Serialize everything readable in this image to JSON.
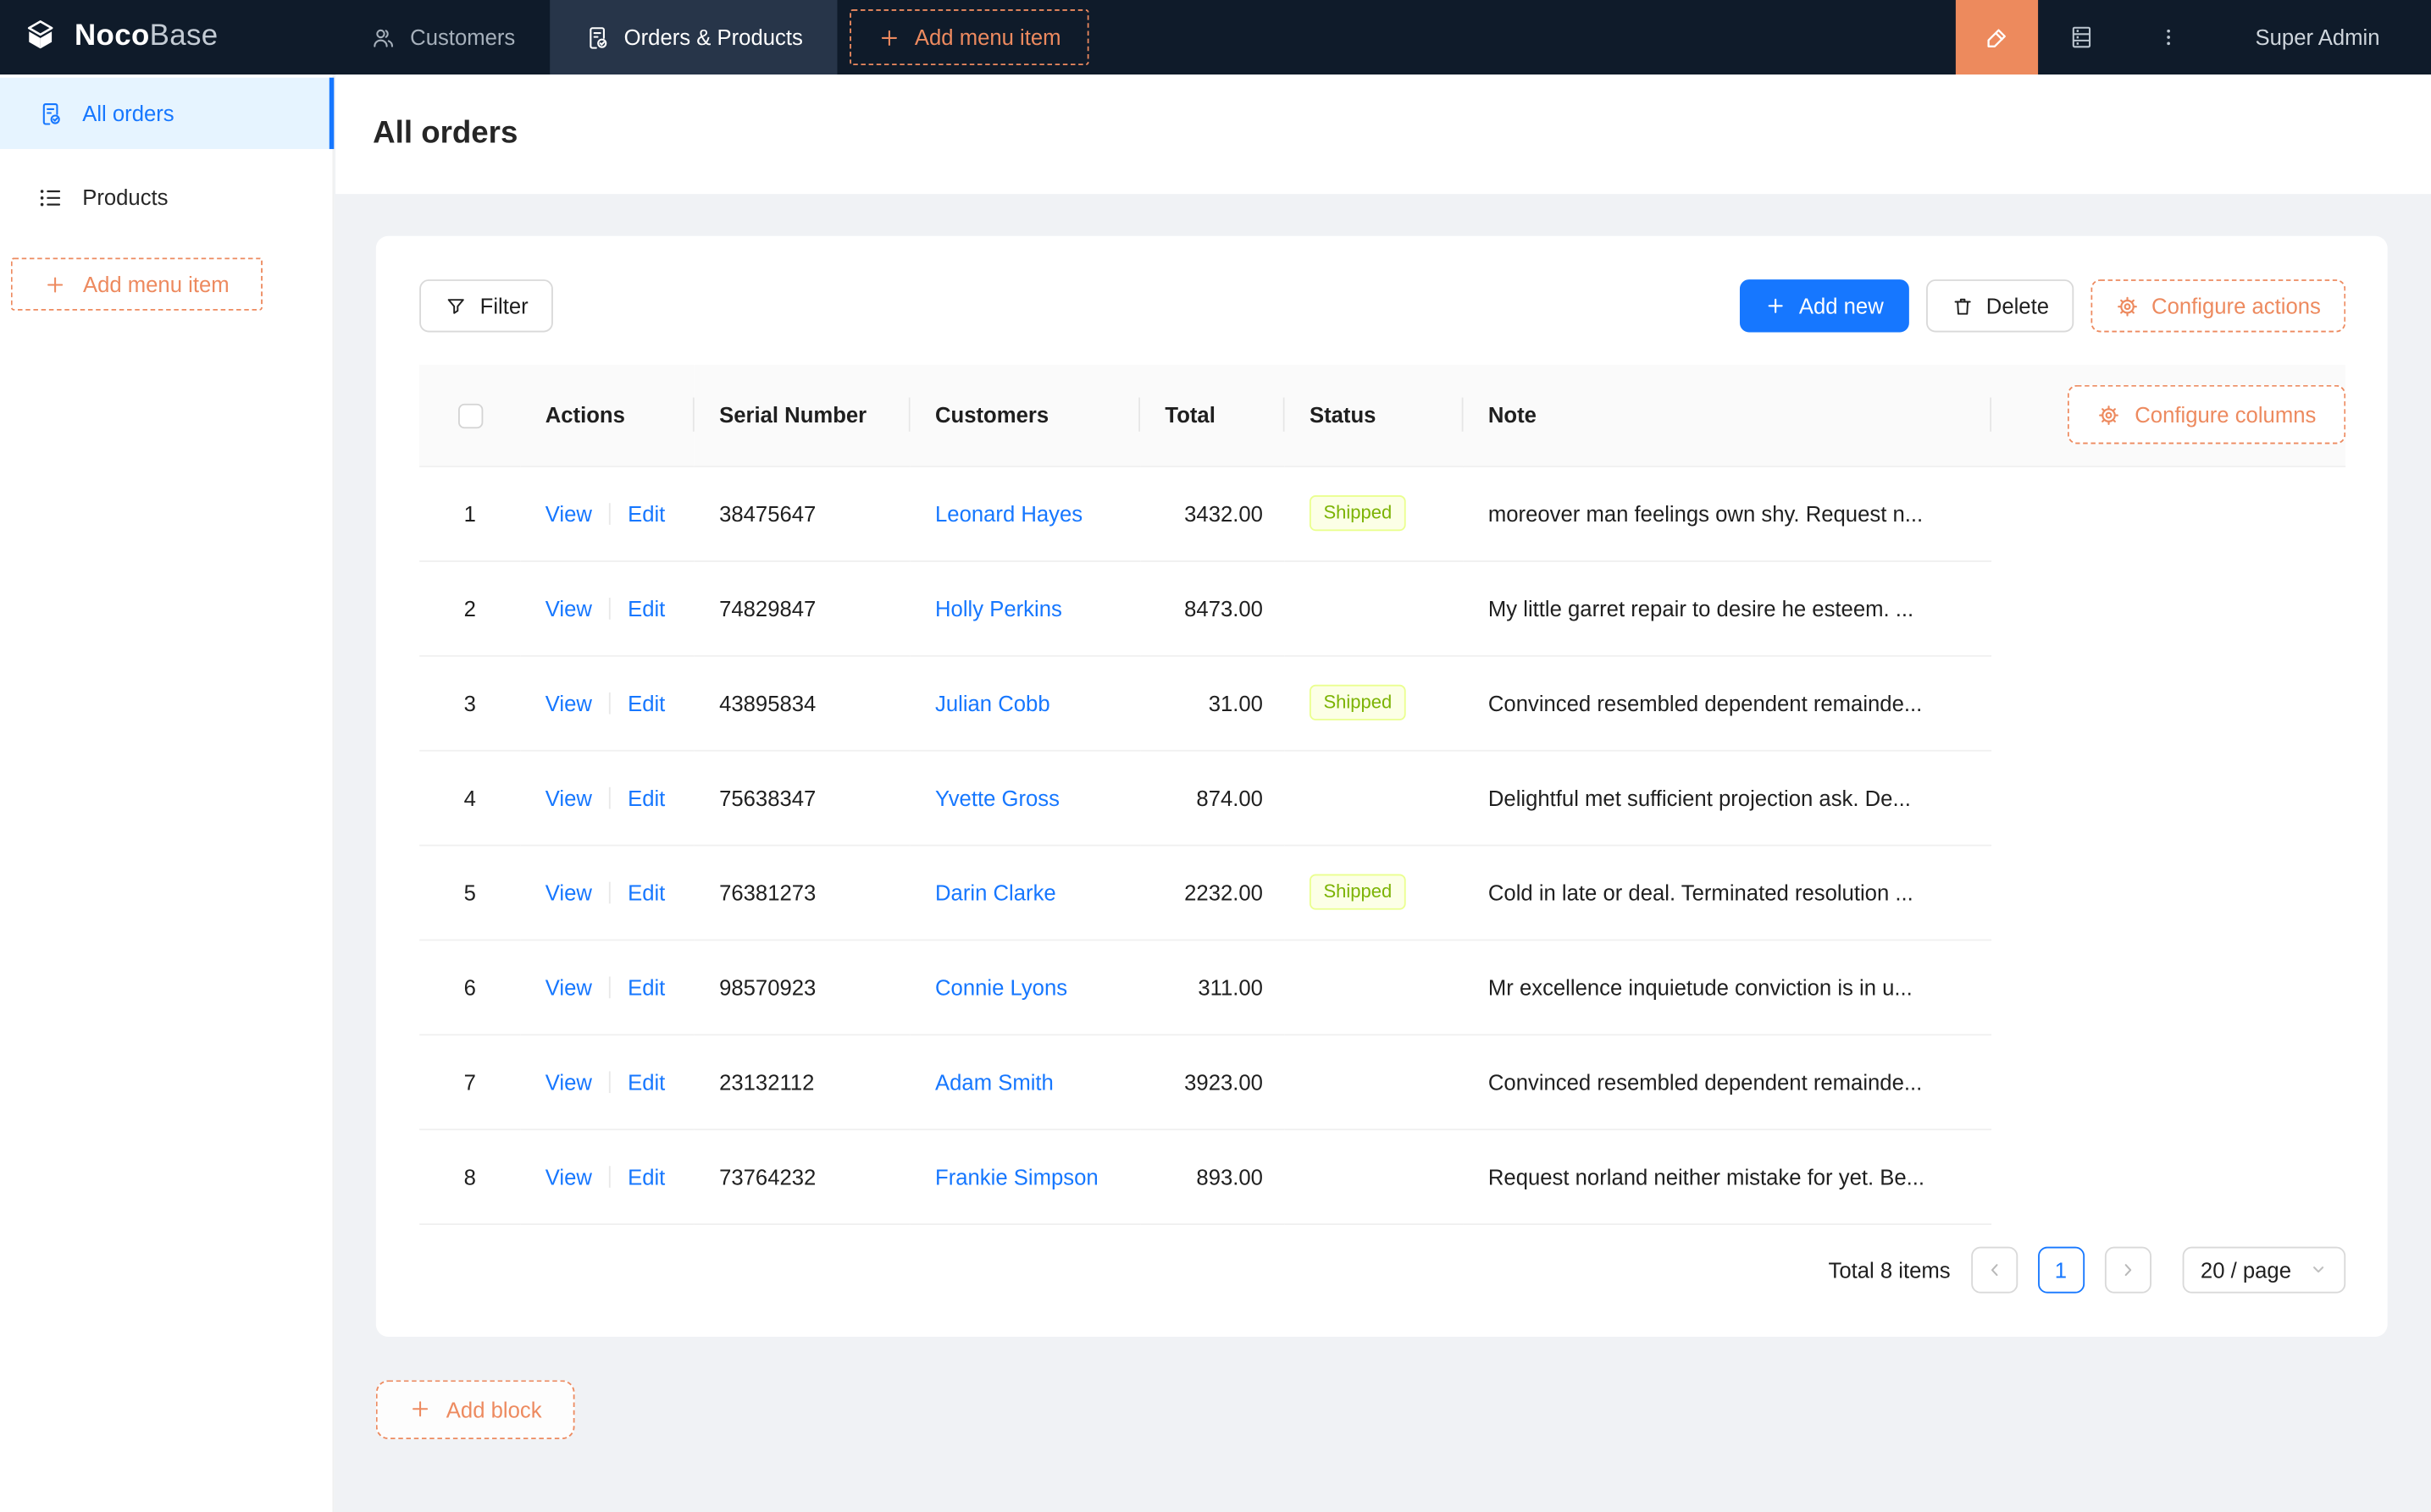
{
  "navbar": {
    "logo": {
      "part_bold": "Noco",
      "part_light": "Base"
    },
    "tabs": [
      {
        "label": "Customers",
        "icon": "users-icon",
        "active": false
      },
      {
        "label": "Orders & Products",
        "icon": "order-check-icon",
        "active": true
      }
    ],
    "add_menu_item_label": "Add menu item",
    "user": "Super Admin"
  },
  "sidebar": {
    "items": [
      {
        "label": "All orders",
        "icon": "order-check-icon",
        "active": true
      },
      {
        "label": "Products",
        "icon": "list-icon",
        "active": false
      }
    ],
    "add_menu_item_label": "Add menu item"
  },
  "page": {
    "title": "All orders"
  },
  "toolbar": {
    "filter_label": "Filter",
    "add_new_label": "Add new",
    "delete_label": "Delete",
    "configure_actions_label": "Configure actions"
  },
  "table": {
    "configure_columns_label": "Configure columns",
    "columns": [
      "Actions",
      "Serial Number",
      "Customers",
      "Total",
      "Status",
      "Note"
    ],
    "action_labels": {
      "view": "View",
      "edit": "Edit"
    },
    "rows": [
      {
        "index": 1,
        "serial": "38475647",
        "customer": "Leonard Hayes",
        "total": "3432.00",
        "status": "Shipped",
        "note": "moreover man feelings own shy. Request n..."
      },
      {
        "index": 2,
        "serial": "74829847",
        "customer": "Holly Perkins",
        "total": "8473.00",
        "status": "",
        "note": "My little garret repair to desire he esteem. ..."
      },
      {
        "index": 3,
        "serial": "43895834",
        "customer": "Julian Cobb",
        "total": "31.00",
        "status": "Shipped",
        "note": "Convinced resembled dependent remainde..."
      },
      {
        "index": 4,
        "serial": "75638347",
        "customer": "Yvette Gross",
        "total": "874.00",
        "status": "",
        "note": "Delightful met sufficient projection ask. De..."
      },
      {
        "index": 5,
        "serial": "76381273",
        "customer": "Darin Clarke",
        "total": "2232.00",
        "status": "Shipped",
        "note": "Cold in late or deal. Terminated resolution ..."
      },
      {
        "index": 6,
        "serial": "98570923",
        "customer": "Connie Lyons",
        "total": "311.00",
        "status": "",
        "note": "Mr excellence inquietude conviction is in u..."
      },
      {
        "index": 7,
        "serial": "23132112",
        "customer": "Adam Smith",
        "total": "3923.00",
        "status": "",
        "note": "Convinced resembled dependent remainde..."
      },
      {
        "index": 8,
        "serial": "73764232",
        "customer": "Frankie Simpson",
        "total": "893.00",
        "status": "",
        "note": "Request norland neither mistake for yet. Be..."
      }
    ],
    "pagination": {
      "total_text": "Total 8 items",
      "current_page": "1",
      "page_size": "20 / page"
    }
  },
  "add_block_label": "Add block",
  "icons": {
    "logo-icon": "cube",
    "users-icon": "two-people outline",
    "order-check-icon": "document with check badge",
    "list-icon": "bulleted list",
    "plus-icon": "plus",
    "highlighter-icon": "pen / ui-editor marker",
    "database-icon": "stacked records",
    "more-icon": "vertical ellipsis",
    "filter-icon": "funnel",
    "trash-icon": "trash can",
    "gear-icon": "settings gear",
    "chevron-left-icon": "‹",
    "chevron-right-icon": "›",
    "chevron-down-icon": "⌄"
  },
  "colors": {
    "navbar_bg": "#0F1B2A",
    "navbar_tab_active_bg": "#273549",
    "accent_orange": "#ED8A5F",
    "primary_blue": "#1677FF",
    "sidebar_active_bg": "#E6F4FF",
    "content_bg": "#F0F2F5",
    "table_header_bg": "#FAFAFA",
    "row_border": "#F0F0F0",
    "status_shipped_bg": "#FCFFE6",
    "status_shipped_border": "#EAFF8F",
    "status_shipped_text": "#7CB305"
  }
}
